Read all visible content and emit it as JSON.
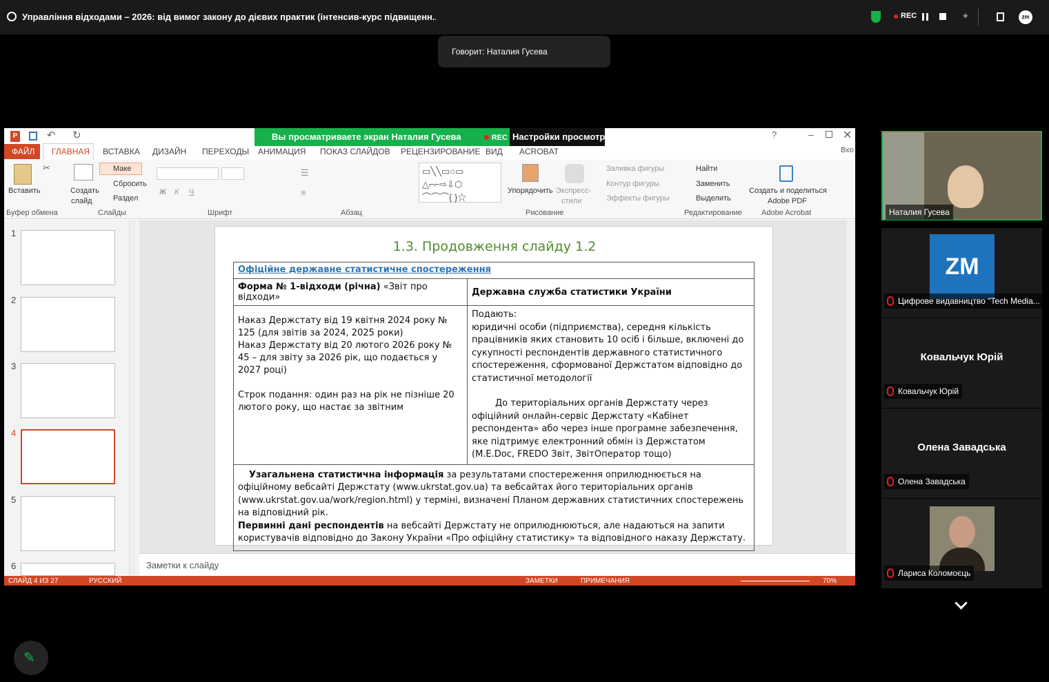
{
  "meeting": {
    "title": "Управління відходами – 2026: від вимог закону до дієвих практик (інтенсив-курс підвищенн...",
    "rec": "REC",
    "speaking": "Говорит: Наталия Гусева"
  },
  "share_banner": {
    "text": "Вы просматриваете экран  Наталия Гусева",
    "rec": "REC",
    "options": "Настройки просмотра"
  },
  "ppt": {
    "quick": "Вхо",
    "tabs": [
      "ФАЙЛ",
      "ГЛАВНАЯ",
      "ВСТАВКА",
      "ДИЗАЙН",
      "ПЕРЕХОДЫ",
      "АНИМАЦИЯ",
      "ПОКАЗ СЛАЙДОВ",
      "РЕЦЕНЗИРОВАНИЕ",
      "ВИД",
      "ACROBAT"
    ],
    "ribbon": {
      "paste": "Вставить",
      "new_slide1": "Создать",
      "new_slide2": "слайд",
      "layout": "Маке",
      "reset": "Сбросить",
      "section": "Раздел",
      "arrange": "Упорядочить",
      "quick_styles1": "Экспресс-",
      "quick_styles2": "стили",
      "fill": "Заливка фигуры",
      "outline": "Контур фигуры",
      "effects": "Эффекты фигуры",
      "find": "Найти",
      "replace": "Заменить",
      "select": "Выделить",
      "acrobat1": "Создать и поделиться",
      "acrobat2": "Adobe PDF"
    },
    "groups": [
      "Буфер обмена",
      "Слайды",
      "Шрифт",
      "Абзац",
      "Рисование",
      "Редактирование",
      "Adobe Acrobat"
    ],
    "thumbs": [
      "1",
      "2",
      "3",
      "4",
      "5",
      "6"
    ],
    "notes": "Заметки к слайду",
    "status": {
      "slide": "СЛАЙД 4 ИЗ 27",
      "lang": "РУССКИЙ",
      "notes": "ЗАМЕТКИ",
      "comments": "ПРИМЕЧАНИЯ",
      "zoom": "70%"
    }
  },
  "slide": {
    "title": "1.3. Продовження слайду 1.2",
    "header": "Офіційне державне статистичне спостереження",
    "form_bold": "Форма № 1-відходи (річна)",
    "form_rest": " «Звіт про відходи»",
    "service": "Державна служба статистики України",
    "orders": "Наказ Держстату від 19 квітня 2024 року № 125 (для звітів за 2024, 2025 роки)\nНаказ Держстату від 20 лютого 2026 року № 45 – для звіту за 2026 рік, що подається у 2027 році)\n\nСтрок подання: один раз на рік не пізніше 20 лютого року, що настає за звітним",
    "submit_p1": "Подають:\nюридичні особи (підприємства), середня кількість працівників яких становить 10 осіб і більше, включені до сукупності респондентів державного статистичного спостереження, сформованої Держстатом відповідно до статистичної методології",
    "submit_p2": "До територіальних органів Держстату через офіційний онлайн-сервіс Держстату «Кабінет респондента» або через інше програмне забезпечення, яке підтримує електронний обмін із Держстатом (M.E.Doc, FREDO Звіт, ЗвітОператор тощо)",
    "gen_bold": "Узагальнена статистична інформація",
    "gen_rest": " за результатами спостереження оприлюднюється на офіційному вебсайті Держстату (www.ukrstat.gov.ua) та вебсайтах його територіальних органів (www.ukrstat.gov.ua/work/region.html) у терміні, визначені Планом державних статистичних спостережень на відповідний рік.",
    "prim_bold": "Первинні дані респондентів",
    "prim_rest": " на вебсайті Держстату не оприлюднюються, але надаються на запити користувачів відповідно до Закону України «Про офіційну статистику» та відповідного наказу Держстату."
  },
  "participants": [
    {
      "name": "Наталия Гусева"
    },
    {
      "name": "Цифрове видавництво \"Tech Media..."
    },
    {
      "name": "Ковальчук Юрій",
      "big": "Ковальчук Юрій"
    },
    {
      "name": "Олена Завадська",
      "big": "Олена Завадська"
    },
    {
      "name": "Лариса Коломоєць"
    }
  ],
  "colors": {
    "zoom_green": "#17b14b",
    "ppt_red": "#d24726",
    "slide_green": "#4e8b2e",
    "link_blue": "#2e74b5"
  }
}
